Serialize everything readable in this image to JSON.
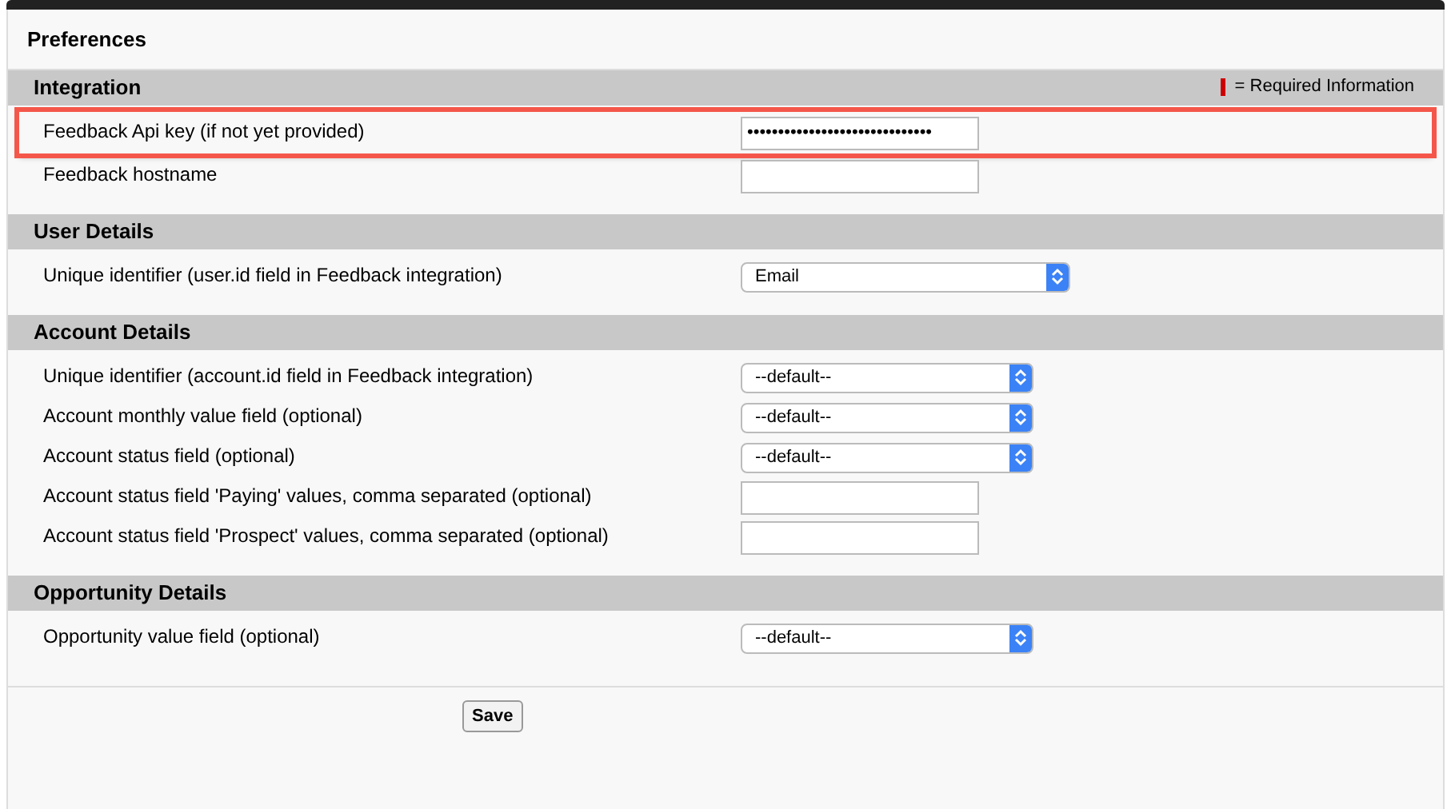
{
  "title": "Preferences",
  "required_legend": "= Required Information",
  "sections": [
    {
      "title": "Integration",
      "fields": [
        {
          "label": "Feedback Api key (if not yet provided)",
          "kind": "text",
          "value": "••••••••••••••••••••••••••••••",
          "highlighted": true
        },
        {
          "label": "Feedback hostname",
          "kind": "text",
          "highlighted": false
        }
      ]
    },
    {
      "title": "User Details",
      "fields": [
        {
          "label": "Unique identifier (user.id field in Feedback integration)",
          "kind": "select",
          "value": "Email",
          "highlighted": false
        }
      ]
    },
    {
      "title": "Account Details",
      "fields": [
        {
          "label": "Unique identifier (account.id field in Feedback integration)",
          "kind": "select",
          "value": "--default--",
          "highlighted": false
        },
        {
          "label": "Account monthly value field (optional)",
          "kind": "select",
          "value": "--default--",
          "highlighted": false
        },
        {
          "label": "Account status field (optional)",
          "kind": "select",
          "value": "--default--",
          "highlighted": false
        },
        {
          "label": "Account status field 'Paying' values, comma separated (optional)",
          "kind": "text",
          "highlighted": false
        },
        {
          "label": "Account status field 'Prospect' values, comma separated (optional)",
          "kind": "text",
          "highlighted": false
        }
      ]
    },
    {
      "title": "Opportunity Details",
      "fields": [
        {
          "label": "Opportunity value field (optional)",
          "kind": "select",
          "value": "--default--",
          "highlighted": false
        }
      ]
    }
  ],
  "save_button": "Save"
}
